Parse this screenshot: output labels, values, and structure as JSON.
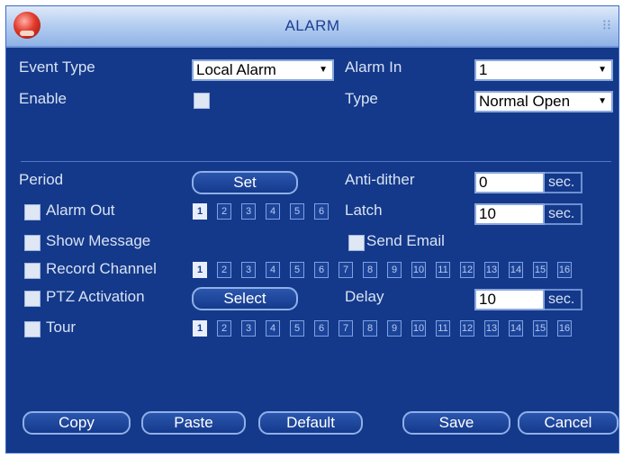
{
  "window": {
    "title": "ALARM"
  },
  "labels": {
    "event_type": "Event Type",
    "enable": "Enable",
    "alarm_in": "Alarm In",
    "type": "Type",
    "period": "Period",
    "anti_dither": "Anti-dither",
    "alarm_out": "Alarm Out",
    "latch": "Latch",
    "show_message": "Show Message",
    "send_email": "Send Email",
    "record_channel": "Record Channel",
    "ptz_activation": "PTZ Activation",
    "delay": "Delay",
    "tour": "Tour"
  },
  "fields": {
    "event_type": "Local Alarm",
    "alarm_in": "1",
    "type": "Normal Open",
    "anti_dither": "0",
    "latch": "10",
    "delay": "10",
    "unit": "sec."
  },
  "buttons": {
    "set": "Set",
    "select": "Select",
    "copy": "Copy",
    "paste": "Paste",
    "default": "Default",
    "save": "Save",
    "cancel": "Cancel"
  },
  "alarm_out_channels": [
    "1",
    "2",
    "3",
    "4",
    "5",
    "6"
  ],
  "alarm_out_selected": [
    1
  ],
  "record_channels": [
    "1",
    "2",
    "3",
    "4",
    "5",
    "6",
    "7",
    "8",
    "9",
    "10",
    "11",
    "12",
    "13",
    "14",
    "15",
    "16"
  ],
  "record_selected": [
    1
  ],
  "tour_channels": [
    "1",
    "2",
    "3",
    "4",
    "5",
    "6",
    "7",
    "8",
    "9",
    "10",
    "11",
    "12",
    "13",
    "14",
    "15",
    "16"
  ],
  "tour_selected": [
    1
  ],
  "colors": {
    "panel": "#14398a",
    "titlebar": "#b6cff1",
    "text": "#d8e2f4",
    "channel_selected": "#e8eefb"
  },
  "icons": {
    "app": "red-circle-app-icon",
    "close": "close-icon"
  }
}
